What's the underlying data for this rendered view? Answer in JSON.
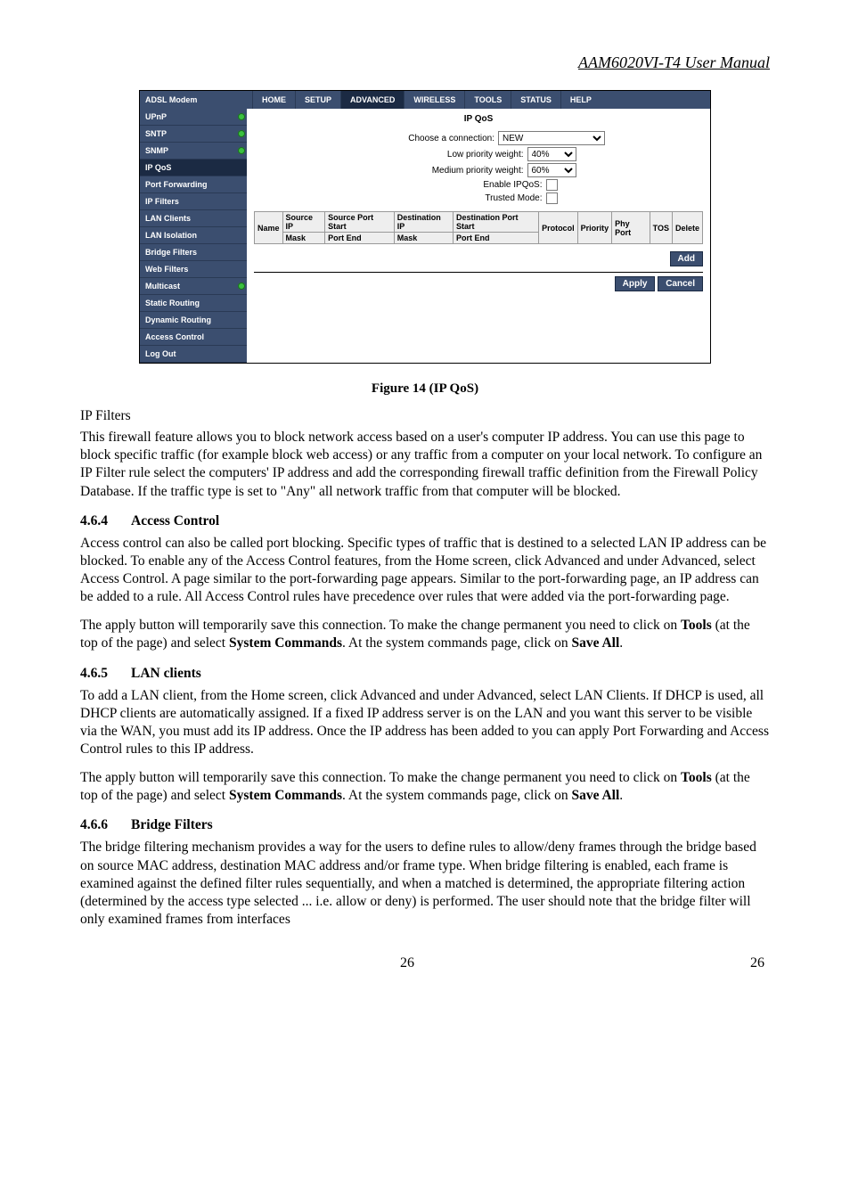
{
  "doc": {
    "header": "AAM6020VI-T4 User Manual",
    "page_number_center": "26",
    "page_number_right": "26"
  },
  "screenshot": {
    "brand": "ADSL Modem",
    "tabs": [
      "HOME",
      "SETUP",
      "ADVANCED",
      "WIRELESS",
      "TOOLS",
      "STATUS",
      "HELP"
    ],
    "active_tab_index": 2,
    "sidebar": [
      {
        "label": "UPnP",
        "indicator": true
      },
      {
        "label": "SNTP",
        "indicator": true
      },
      {
        "label": "SNMP",
        "indicator": true
      },
      {
        "label": "IP QoS",
        "active": true
      },
      {
        "label": "Port Forwarding"
      },
      {
        "label": "IP Filters"
      },
      {
        "label": "LAN Clients"
      },
      {
        "label": "LAN Isolation"
      },
      {
        "label": "Bridge Filters"
      },
      {
        "label": "Web Filters"
      },
      {
        "label": "Multicast",
        "indicator": true
      },
      {
        "label": "Static Routing"
      },
      {
        "label": "Dynamic Routing"
      },
      {
        "label": "Access Control"
      },
      {
        "label": "Log Out"
      }
    ],
    "content": {
      "title": "IP QoS",
      "choose_connection_label": "Choose a connection:",
      "choose_connection_value": "NEW",
      "low_priority_label": "Low priority weight:",
      "low_priority_value": "40%",
      "medium_priority_label": "Medium priority weight:",
      "medium_priority_value": "60%",
      "enable_label": "Enable IPQoS:",
      "trusted_label": "Trusted Mode:",
      "table_headers_row1": [
        "Name",
        "Source IP Mask",
        "Source Port Start Port End",
        "Destination IP Mask",
        "Destination Port Start Port End",
        "Protocol",
        "Priority",
        "Phy Port",
        "TOS",
        "Delete"
      ],
      "th": {
        "name": "Name",
        "src_ip": "Source IP",
        "src_mask": "Mask",
        "src_port_start": "Source Port Start",
        "src_port_end": "Port End",
        "dst_ip": "Destination IP",
        "dst_mask": "Mask",
        "dst_port_start": "Destination Port Start",
        "dst_port_end": "Port End",
        "protocol": "Protocol",
        "priority": "Priority",
        "phy_port": "Phy Port",
        "tos": "TOS",
        "delete": "Delete"
      },
      "add_btn": "Add",
      "apply_btn": "Apply",
      "cancel_btn": "Cancel"
    }
  },
  "figure_caption": "Figure 14 (IP QoS)",
  "sections": {
    "ip_filters_heading": "IP Filters",
    "ip_filters_body": "This firewall feature allows you to block network access based on a user's computer IP address. You can use this page to block specific traffic (for example block web access) or any traffic from a computer on your local network. To configure an IP Filter rule select the computers' IP address and add the corresponding firewall traffic definition from the Firewall Policy Database. If the traffic type is set to \"Any\" all network traffic from that computer will be blocked.",
    "s464_num": "4.6.4",
    "s464_title": "Access Control",
    "s464_p1": "Access control can also be called port blocking.  Specific types of traffic that is destined to a selected LAN IP address can be blocked.  To enable any of the Access Control features, from the Home screen, click Advanced and under Advanced, select Access Control.  A page similar to the port-forwarding page appears.  Similar to the port-forwarding page, an IP address can be added to a rule.  All Access Control rules have precedence over rules that were added via the port-forwarding page.",
    "s464_p2_pre": "The apply button will temporarily save this connection. To make the change permanent you need to click on ",
    "s464_p2_bold1": "Tools",
    "s464_p2_mid": " (at the top of the page) and select ",
    "s464_p2_bold2": "System Commands",
    "s464_p2_post": ".  At the system commands page, click on ",
    "s464_p2_bold3": "Save All",
    "s464_p2_end": ".",
    "s465_num": "4.6.5",
    "s465_title": "LAN clients",
    "s465_p1": "To add a LAN client, from the Home screen, click Advanced and under Advanced, select LAN Clients.  If DHCP is used, all DHCP clients are automatically assigned.  If a fixed IP address server is on the LAN and you want this server to be visible via the WAN, you must add its IP address.  Once the IP address has been added to you can apply Port Forwarding and Access Control rules to this IP address.",
    "s466_num": "4.6.6",
    "s466_title": "Bridge Filters",
    "s466_p1": "The bridge filtering mechanism provides a way for the users to define rules to allow/deny frames through the bridge based on source MAC address, destination MAC address and/or frame type. When bridge filtering is enabled, each frame is examined against the defined filter rules sequentially, and when a matched is determined, the appropriate filtering action (determined by the access type selected ... i.e. allow or deny) is performed. The user should note that the bridge filter will only examined frames from interfaces"
  }
}
